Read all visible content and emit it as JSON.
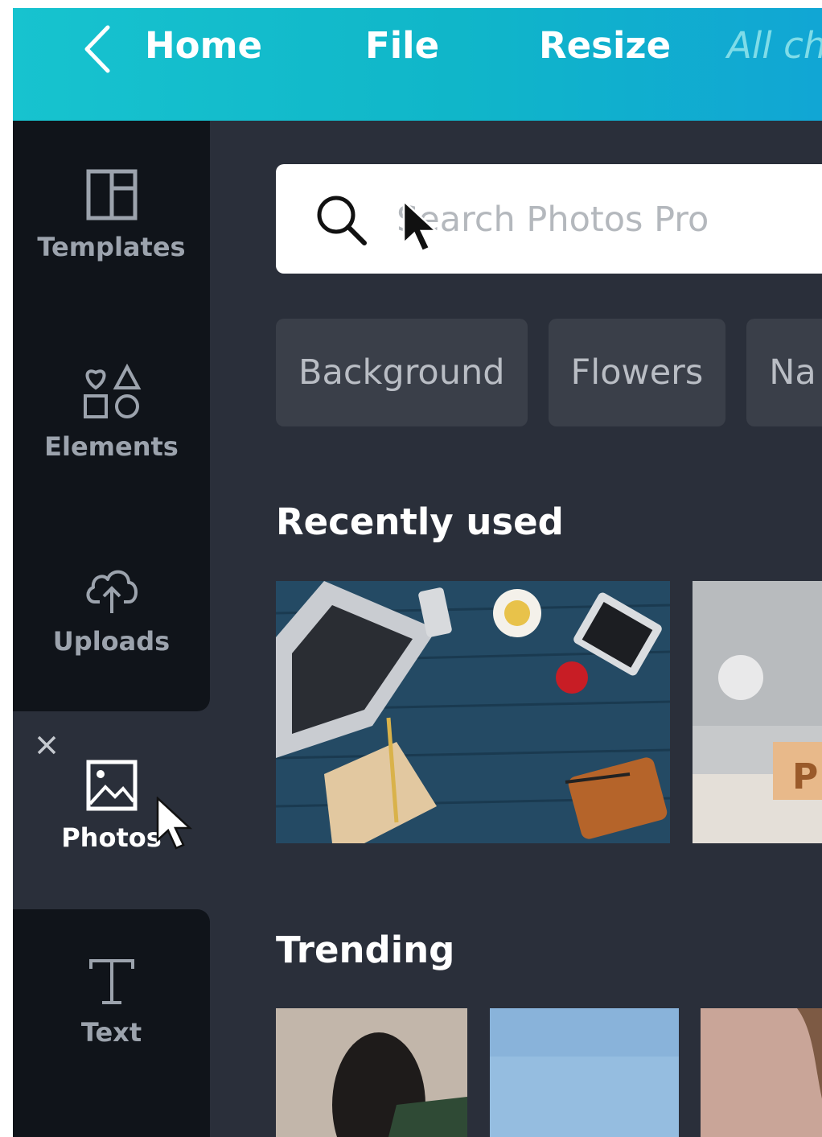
{
  "topbar": {
    "home_label": "Home",
    "file_label": "File",
    "resize_label": "Resize",
    "status_text": "All ch"
  },
  "sidebar": {
    "items": [
      {
        "label": "Templates",
        "icon": "templates-icon"
      },
      {
        "label": "Elements",
        "icon": "elements-icon"
      },
      {
        "label": "Uploads",
        "icon": "upload-cloud-icon"
      },
      {
        "label": "Photos",
        "icon": "image-icon",
        "active": true
      },
      {
        "label": "Text",
        "icon": "text-icon"
      }
    ]
  },
  "search": {
    "placeholder": "Search Photos Pro",
    "value": ""
  },
  "chips": [
    "Background",
    "Flowers",
    "Na"
  ],
  "sections": {
    "recent_title": "Recently used",
    "trending_title": "Trending"
  },
  "colors": {
    "topbar_start": "#17c3cf",
    "topbar_end": "#11a6d4",
    "sidebar_dark": "#10141a",
    "panel": "#2a2f3a",
    "chip": "#3a3f49"
  }
}
